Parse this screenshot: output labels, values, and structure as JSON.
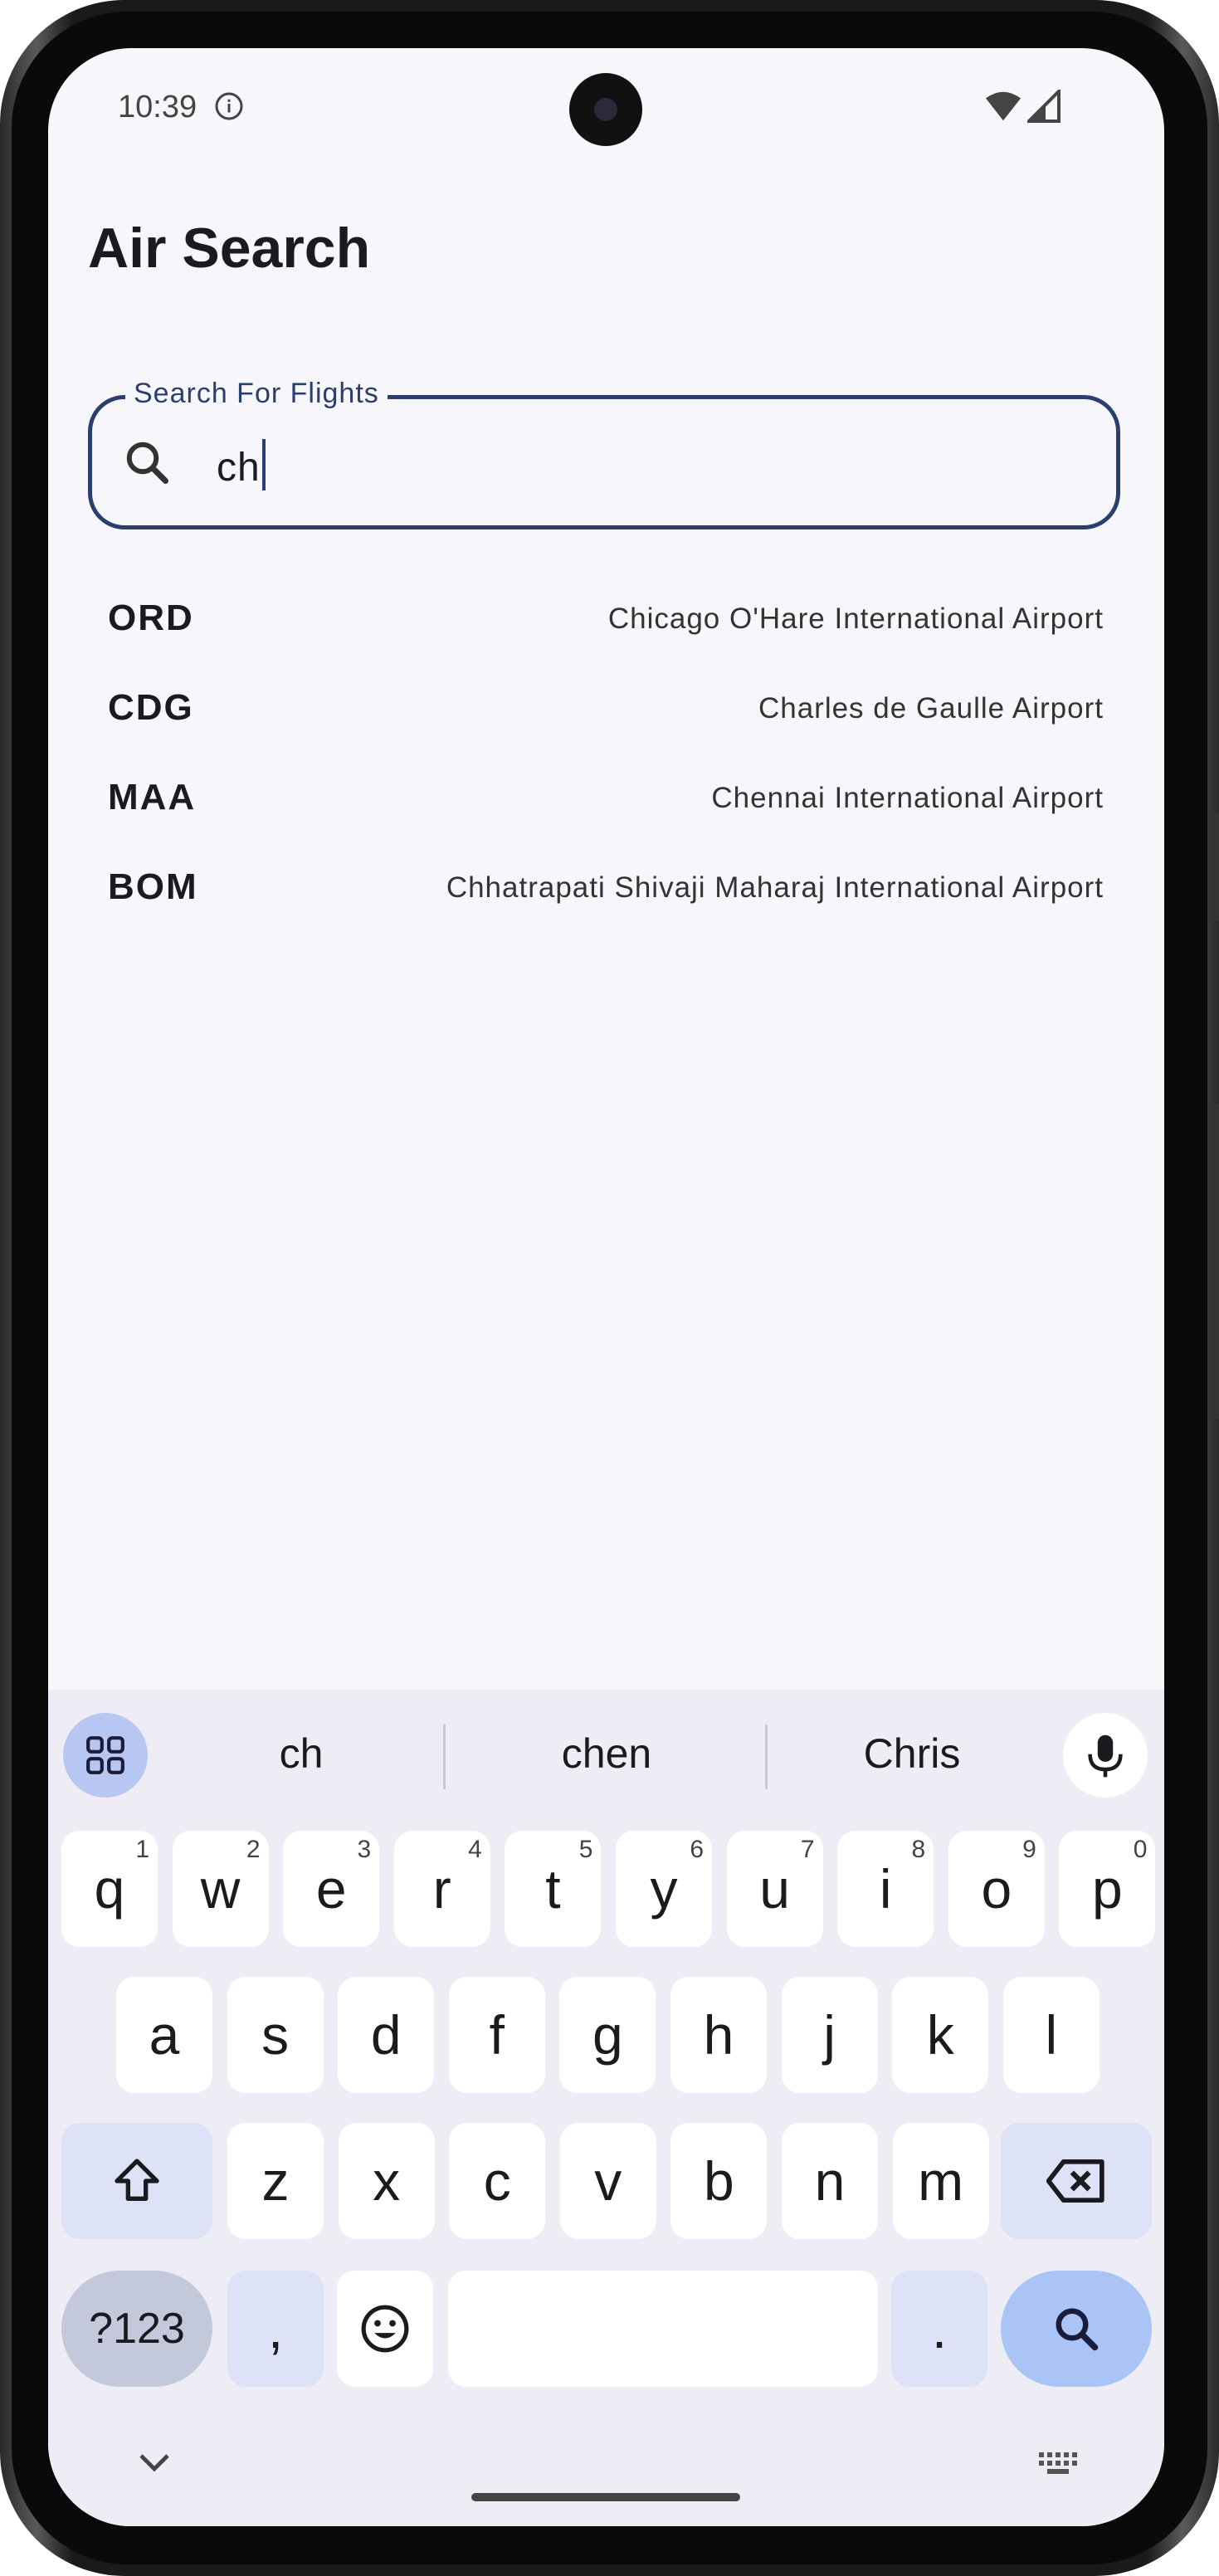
{
  "status_bar": {
    "time": "10:39"
  },
  "app": {
    "title": "Air Search"
  },
  "search": {
    "label": "Search For Flights",
    "value": "ch"
  },
  "results": [
    {
      "code": "ORD",
      "name": "Chicago O'Hare International Airport"
    },
    {
      "code": "CDG",
      "name": "Charles de Gaulle Airport"
    },
    {
      "code": "MAA",
      "name": "Chennai International Airport"
    },
    {
      "code": "BOM",
      "name": "Chhatrapati Shivaji Maharaj International Airport"
    }
  ],
  "keyboard": {
    "suggestions": [
      "ch",
      "chen",
      "Chris"
    ],
    "row1": [
      {
        "k": "q",
        "n": "1"
      },
      {
        "k": "w",
        "n": "2"
      },
      {
        "k": "e",
        "n": "3"
      },
      {
        "k": "r",
        "n": "4"
      },
      {
        "k": "t",
        "n": "5"
      },
      {
        "k": "y",
        "n": "6"
      },
      {
        "k": "u",
        "n": "7"
      },
      {
        "k": "i",
        "n": "8"
      },
      {
        "k": "o",
        "n": "9"
      },
      {
        "k": "p",
        "n": "0"
      }
    ],
    "row2": [
      "a",
      "s",
      "d",
      "f",
      "g",
      "h",
      "j",
      "k",
      "l"
    ],
    "row3": [
      "z",
      "x",
      "c",
      "v",
      "b",
      "n",
      "m"
    ],
    "symbols_label": "?123",
    "comma": ",",
    "period": "."
  },
  "colors": {
    "accent": "#2b3f6e",
    "background": "#f7f6fb",
    "keyboard_bg": "#eeedf5",
    "enter_key": "#a9c4f5"
  }
}
